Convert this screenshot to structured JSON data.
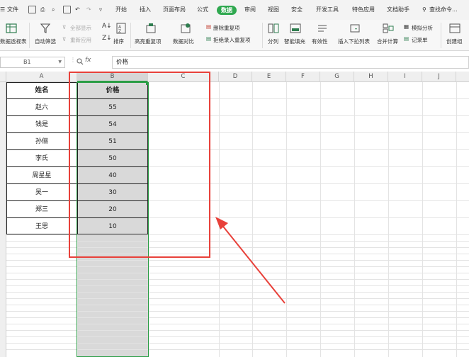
{
  "menubar": {
    "items": [
      "文件",
      "开始",
      "插入",
      "页面布局",
      "公式",
      "数据",
      "审阅",
      "视图",
      "安全",
      "开发工具",
      "特色应用",
      "文档助手",
      "查找命令..."
    ],
    "active": "数据",
    "accent": "#2fa84f"
  },
  "ribbon": {
    "pivot": "数据透视表",
    "autofilter": "自动筛选",
    "showall": "全部显示",
    "reapply": "重新应用",
    "sort": "排序",
    "highlight_dup": "高亮重复项",
    "compare": "数据对比",
    "remove_dup": "删除重复项",
    "reject_dup": "拒绝录入重复项",
    "split": "分列",
    "smartfill": "智能填充",
    "validity": "有效性",
    "dropdown": "插入下拉列表",
    "consolidate": "合并计算",
    "whatif": "模拟分析",
    "record": "记录单",
    "creategroup": "创建组"
  },
  "formula": {
    "namebox": "B1",
    "fx": "fx",
    "value": "价格"
  },
  "columns": [
    "A",
    "B",
    "C",
    "D",
    "E",
    "F",
    "G",
    "H",
    "I",
    "J"
  ],
  "table": {
    "headers": [
      "姓名",
      "价格"
    ],
    "rows": [
      [
        "赵六",
        "55"
      ],
      [
        "钱是",
        "54"
      ],
      [
        "孙俪",
        "51"
      ],
      [
        "李氏",
        "50"
      ],
      [
        "周星星",
        "40"
      ],
      [
        "吴一",
        "30"
      ],
      [
        "郑三",
        "20"
      ],
      [
        "王思",
        "10"
      ]
    ]
  },
  "colors": {
    "selection": "#2a9d45",
    "annotation": "#e8413a",
    "selected_fill": "#d9d9d9"
  }
}
